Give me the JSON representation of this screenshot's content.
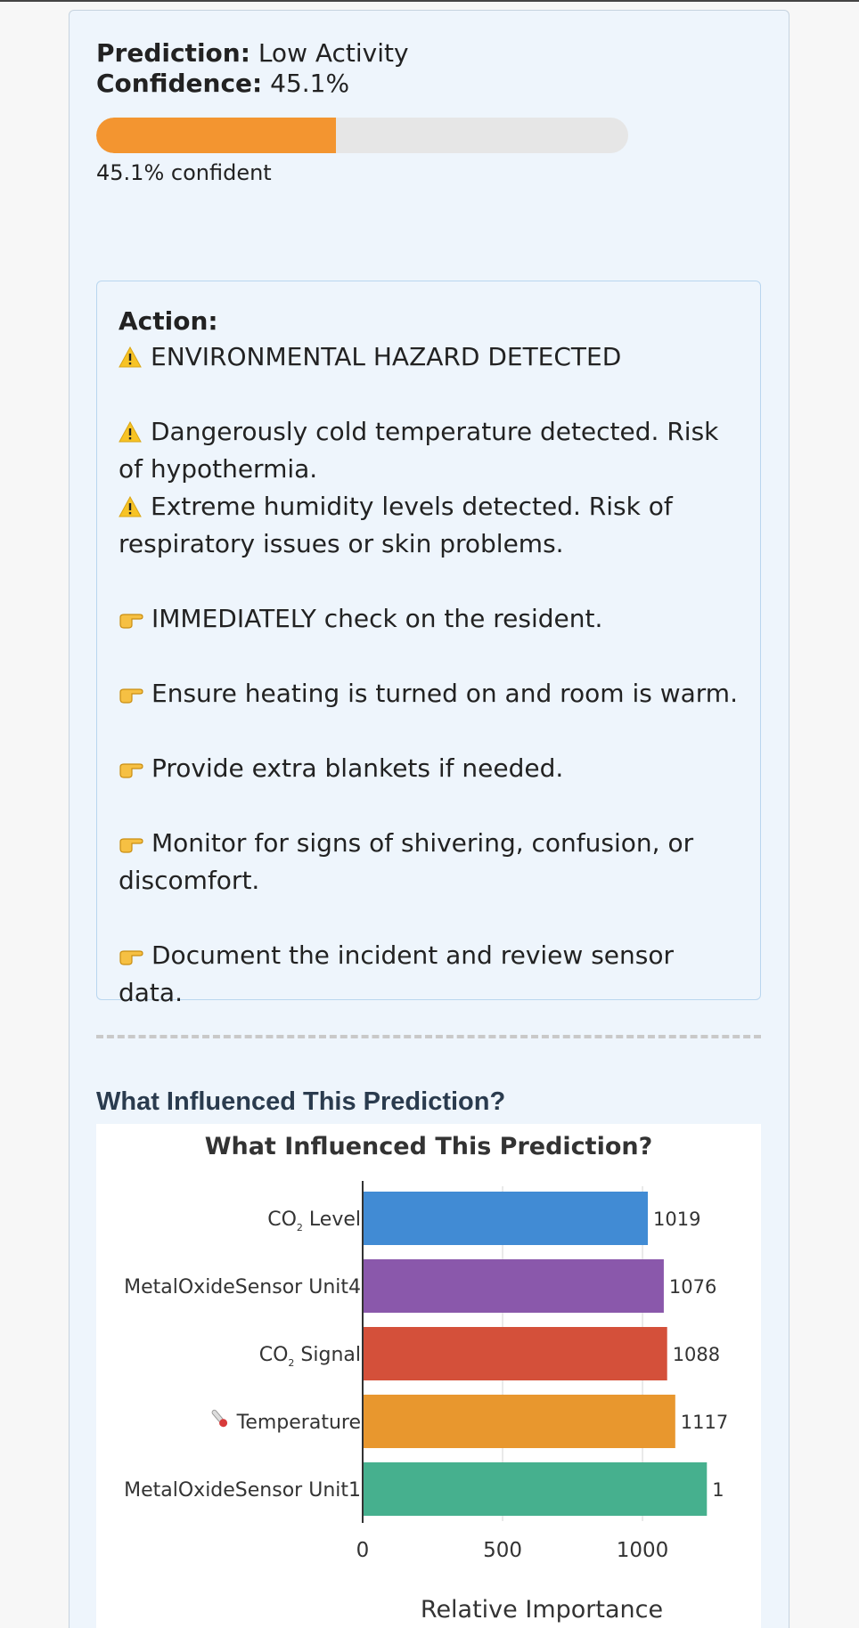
{
  "prediction": {
    "prediction_label": "Prediction:",
    "prediction_value": "Low Activity",
    "confidence_label": "Confidence:",
    "confidence_value": "45.1%",
    "confidence_fraction": 0.451,
    "progress_caption": "45.1% confident",
    "bar_color": "#f39530"
  },
  "action": {
    "title": "Action:",
    "hazard_line": "ENVIRONMENTAL HAZARD DETECTED",
    "warnings": [
      {
        "icon": "warning-icon",
        "text": "Dangerously cold temperature detected. Risk of hypothermia."
      },
      {
        "icon": "warning-icon",
        "text": "Extreme humidity levels detected. Risk of respiratory issues or skin problems."
      }
    ],
    "steps": [
      {
        "icon": "pointing-hand-icon",
        "text": "IMMEDIATELY check on the resident."
      },
      {
        "icon": "pointing-hand-icon",
        "text": "Ensure heating is turned on and room is warm."
      },
      {
        "icon": "pointing-hand-icon",
        "text": "Provide extra blankets if needed."
      },
      {
        "icon": "pointing-hand-icon",
        "text": "Monitor for signs of shivering, confusion, or discomfort."
      },
      {
        "icon": "pointing-hand-icon",
        "text": "Document the incident and review sensor data."
      }
    ]
  },
  "influence": {
    "heading": "What Influenced This Prediction?"
  },
  "chart_data": {
    "type": "bar",
    "orientation": "horizontal",
    "title": "What Influenced This Prediction?",
    "xlabel": "Relative Importance",
    "ylabel": "",
    "xlim": [
      0,
      1280
    ],
    "xticks": [
      0,
      500,
      1000
    ],
    "grid": true,
    "categories": [
      {
        "text": "CO",
        "sub": "2",
        "after": " Level"
      },
      {
        "text": "MetalOxideSensor Unit4",
        "sub": "",
        "after": ""
      },
      {
        "text": "CO",
        "sub": "2",
        "after": " Signal"
      },
      {
        "text": "Temperature",
        "sub": "",
        "after": "",
        "icon": "thermometer-icon"
      },
      {
        "text": "MetalOxideSensor Unit1",
        "sub": "",
        "after": ""
      }
    ],
    "values": [
      1019,
      1076,
      1088,
      1117,
      1230
    ],
    "data_labels": [
      "1019",
      "1076",
      "1088",
      "1117",
      "1"
    ],
    "colors": [
      "#418bd4",
      "#8a58ab",
      "#d4503a",
      "#e8972e",
      "#46b08e"
    ]
  }
}
